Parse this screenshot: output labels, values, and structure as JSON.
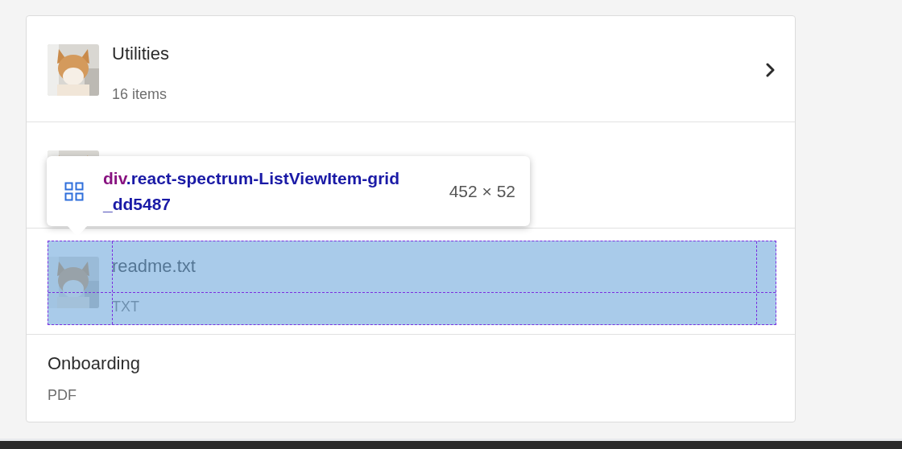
{
  "list": {
    "items": [
      {
        "title": "Utilities",
        "subtitle": "16 items",
        "has_children": true,
        "inspected": false
      },
      {
        "has_children": false,
        "inspected": false
      },
      {
        "title": "readme.txt",
        "subtitle": "TXT",
        "has_children": false,
        "inspected": true
      },
      {
        "title": "Onboarding",
        "subtitle": "PDF",
        "has_children": false,
        "inspected": false
      }
    ]
  },
  "inspector_tooltip": {
    "tag": "div",
    "selector": ".react-spectrum-ListViewItem-grid_dd5487",
    "size": "452 × 52"
  }
}
